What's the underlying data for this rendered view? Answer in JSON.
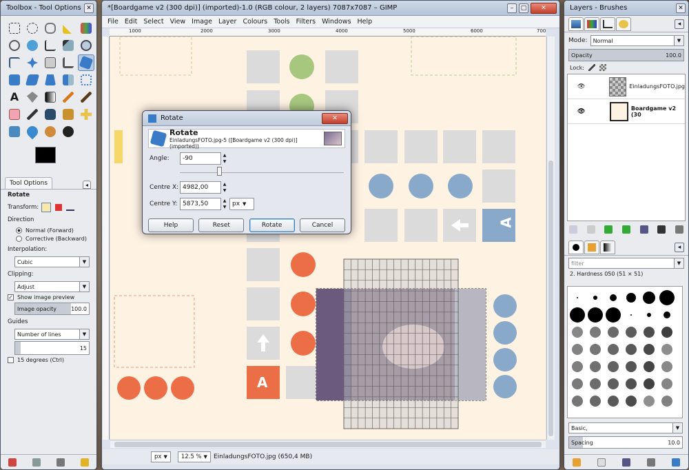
{
  "toolbox": {
    "title": "Toolbox - Tool Options",
    "tab_label": "Tool Options",
    "tool_name": "Rotate",
    "transform_label": "Transform:",
    "direction_label": "Direction",
    "direction_options": [
      "Normal (Forward)",
      "Corrective (Backward)"
    ],
    "direction_selected": "Normal (Forward)",
    "interpolation_label": "Interpolation:",
    "interpolation_value": "Cubic",
    "clipping_label": "Clipping:",
    "clipping_value": "Adjust",
    "show_preview_label": "Show image preview",
    "show_preview_checked": true,
    "opacity_label": "Image opacity",
    "opacity_value": "100.0",
    "opacity_fraction": 1.0,
    "guides_label": "Guides",
    "guides_value": "Number of lines",
    "lines_value": "15",
    "degrees_label": "15 degrees  (Ctrl)",
    "degrees_checked": false
  },
  "main": {
    "title": "*[Boardgame v2 (300 dpi)] (imported)-1.0 (RGB colour, 2 layers) 7087x7087 – GIMP",
    "menu": [
      "File",
      "Edit",
      "Select",
      "View",
      "Image",
      "Layer",
      "Colours",
      "Tools",
      "Filters",
      "Windows",
      "Help"
    ],
    "ruler_ticks": [
      "1000",
      "2000",
      "3000",
      "4000",
      "5000",
      "6000",
      "700"
    ],
    "status_unit": "px",
    "status_zoom": "12.5 %",
    "status_text": "EinladungsFOTO.jpg (650,4 MB)",
    "board_letter": "A"
  },
  "dialog": {
    "title": "Rotate",
    "heading": "Rotate",
    "subheading": "EinladungsFOTO.jpg-5 ([Boardgame v2 (300 dpi)] (imported))",
    "angle_label": "Angle:",
    "angle_value": "-90",
    "centre_x_label": "Centre X:",
    "centre_x_value": "4982,00",
    "centre_y_label": "Centre Y:",
    "centre_y_value": "5873,50",
    "unit": "px",
    "buttons": {
      "help": "Help",
      "reset": "Reset",
      "rotate": "Rotate",
      "cancel": "Cancel"
    }
  },
  "layers": {
    "title": "Layers - Brushes",
    "mode_label": "Mode:",
    "mode_value": "Normal",
    "opacity_label": "Opacity",
    "opacity_value": "100.0",
    "lock_label": "Lock:",
    "items": [
      {
        "name": "EinladungsFOTO.jpg",
        "bold": false
      },
      {
        "name": "Boardgame v2 (30",
        "bold": true
      }
    ],
    "filter_placeholder": "filter",
    "brush_name": "2. Hardness 050 (51 × 51)",
    "brush_set": "Basic,",
    "spacing_label": "Spacing",
    "spacing_value": "10.0"
  },
  "colors": {
    "blue": "#88a9c9",
    "orange": "#ec6e47",
    "green": "#a7c77f",
    "gray": "#dbdbdb",
    "board_bg": "#fef2e3"
  }
}
